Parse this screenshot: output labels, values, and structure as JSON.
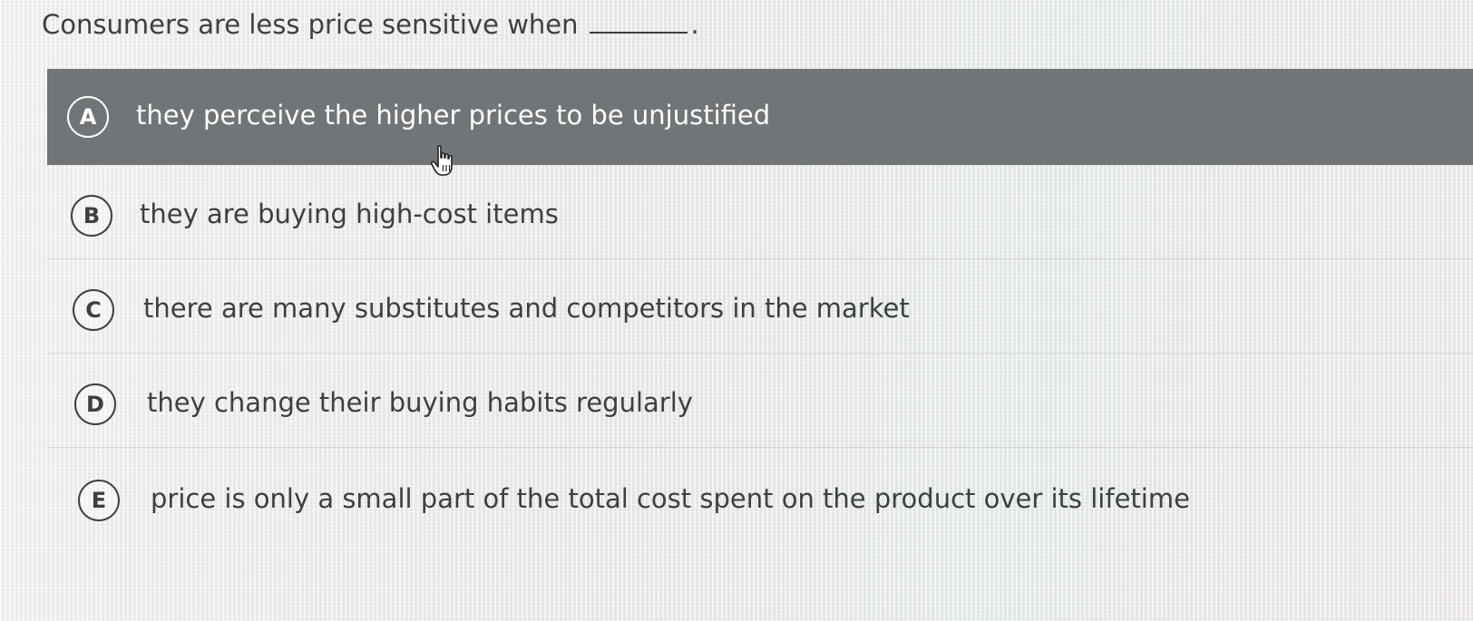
{
  "question": {
    "text": "Consumers are less price sensitive when",
    "end_mark": "."
  },
  "options": [
    {
      "letter": "A",
      "text": "they perceive the higher prices to be unjustified",
      "selected": true
    },
    {
      "letter": "B",
      "text": "they are buying high-cost items",
      "selected": false
    },
    {
      "letter": "C",
      "text": "there are many substitutes and competitors in the market",
      "selected": false
    },
    {
      "letter": "D",
      "text": "they change their buying habits regularly",
      "selected": false
    },
    {
      "letter": "E",
      "text": "price is only a small part of the total cost spent on the product over its lifetime",
      "selected": false
    }
  ],
  "colors": {
    "selected_bg": "#717577",
    "text": "#3c4043",
    "selected_text": "#ffffff"
  },
  "cursor_icon": "hand-pointer-icon"
}
